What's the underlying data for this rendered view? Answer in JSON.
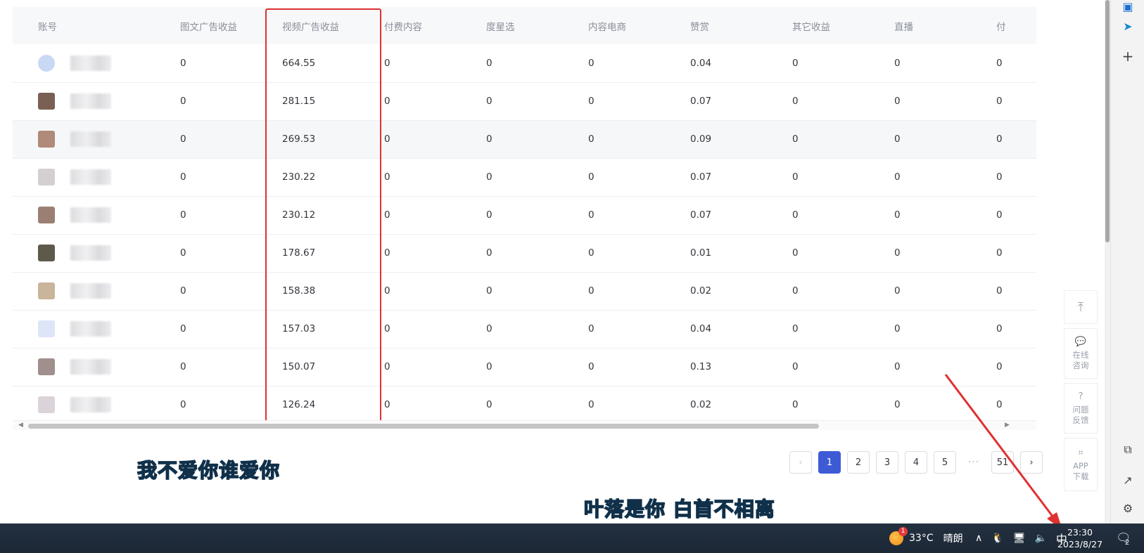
{
  "table": {
    "columns": [
      "账号",
      "图文广告收益",
      "视频广告收益",
      "付费内容",
      "度星选",
      "内容电商",
      "赞赏",
      "其它收益",
      "直播",
      "付"
    ],
    "rows": [
      {
        "text_ad": "0",
        "video_ad": "664.55",
        "paid": "0",
        "duxingxuan": "0",
        "ecommerce": "0",
        "tip": "0.04",
        "other": "0",
        "live": "0",
        "last": "0"
      },
      {
        "text_ad": "0",
        "video_ad": "281.15",
        "paid": "0",
        "duxingxuan": "0",
        "ecommerce": "0",
        "tip": "0.07",
        "other": "0",
        "live": "0",
        "last": "0"
      },
      {
        "text_ad": "0",
        "video_ad": "269.53",
        "paid": "0",
        "duxingxuan": "0",
        "ecommerce": "0",
        "tip": "0.09",
        "other": "0",
        "live": "0",
        "last": "0"
      },
      {
        "text_ad": "0",
        "video_ad": "230.22",
        "paid": "0",
        "duxingxuan": "0",
        "ecommerce": "0",
        "tip": "0.07",
        "other": "0",
        "live": "0",
        "last": "0"
      },
      {
        "text_ad": "0",
        "video_ad": "230.12",
        "paid": "0",
        "duxingxuan": "0",
        "ecommerce": "0",
        "tip": "0.07",
        "other": "0",
        "live": "0",
        "last": "0"
      },
      {
        "text_ad": "0",
        "video_ad": "178.67",
        "paid": "0",
        "duxingxuan": "0",
        "ecommerce": "0",
        "tip": "0.01",
        "other": "0",
        "live": "0",
        "last": "0"
      },
      {
        "text_ad": "0",
        "video_ad": "158.38",
        "paid": "0",
        "duxingxuan": "0",
        "ecommerce": "0",
        "tip": "0.02",
        "other": "0",
        "live": "0",
        "last": "0"
      },
      {
        "text_ad": "0",
        "video_ad": "157.03",
        "paid": "0",
        "duxingxuan": "0",
        "ecommerce": "0",
        "tip": "0.04",
        "other": "0",
        "live": "0",
        "last": "0"
      },
      {
        "text_ad": "0",
        "video_ad": "150.07",
        "paid": "0",
        "duxingxuan": "0",
        "ecommerce": "0",
        "tip": "0.13",
        "other": "0",
        "live": "0",
        "last": "0"
      },
      {
        "text_ad": "0",
        "video_ad": "126.24",
        "paid": "0",
        "duxingxuan": "0",
        "ecommerce": "0",
        "tip": "0.02",
        "other": "0",
        "live": "0",
        "last": "0"
      }
    ],
    "avatar_colors": [
      "#c9d8f5",
      "#7a5f55",
      "#b08a7a",
      "#d4cfd0",
      "#9c7f74",
      "#5e5a4a",
      "#c8b59a",
      "#dde6f7",
      "#a08f8c",
      "#dad4da"
    ],
    "highlighted_column": "视频广告收益"
  },
  "pagination": {
    "pages": [
      "1",
      "2",
      "3",
      "4",
      "5"
    ],
    "ellipsis": "···",
    "last_page": "51",
    "current": "1",
    "prev_icon": "chevron-left-icon",
    "next_icon": "chevron-right-icon"
  },
  "overlays": {
    "caption1": "我不爱你谁爱你",
    "caption2": "叶落是你  白首不相离"
  },
  "float_tools": {
    "back_top_icon": "back-to-top-icon",
    "consult_label": "在线咨询",
    "feedback_label": "问题反馈",
    "app_label": "APP下载"
  },
  "taskbar": {
    "temperature": "33°C",
    "weather": "晴朗",
    "weather_badge": "1",
    "ime": "中",
    "time": "23:30",
    "date": "2023/8/27",
    "notification_count": "2"
  },
  "colors": {
    "accent": "#3e5bd6",
    "highlight_box": "#e03030",
    "arrow": "#e03030"
  }
}
